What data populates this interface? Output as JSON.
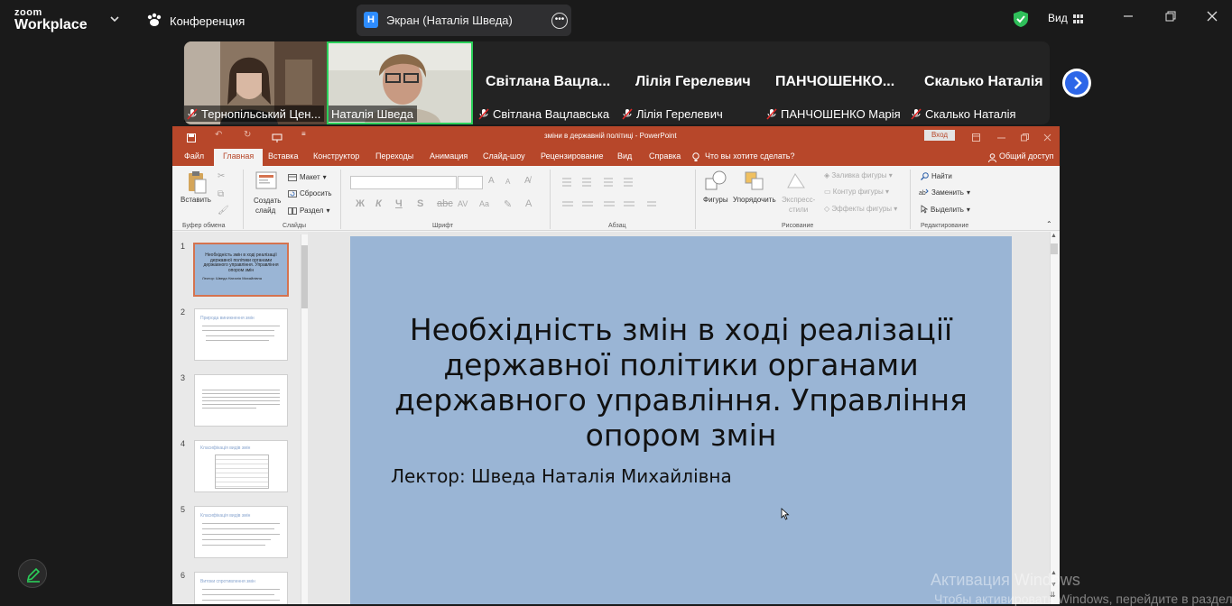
{
  "zoom": {
    "logo_top": "zoom",
    "logo_bottom": "Workplace",
    "meeting_label": "Конференция",
    "share": {
      "badge": "Н",
      "label": "Экран (Наталія Шведа)"
    },
    "view_label": "Вид"
  },
  "participants": {
    "video": [
      {
        "label": "Тернопільський Цен..."
      },
      {
        "label": "Наталія Шведа"
      }
    ],
    "names": [
      {
        "title": "Світлана Вацла...",
        "label": "Світлана Вацлавська"
      },
      {
        "title": "Лілія Герелевич",
        "label": "Лілія Герелевич"
      },
      {
        "title": "ПАНЧОШЕНКО...",
        "label": "ПАНЧОШЕНКО Марія"
      },
      {
        "title": "Скалько Наталія",
        "label": "Скалько Наталія"
      }
    ]
  },
  "powerpoint": {
    "window_title": "зміни в державній політиці  -  PowerPoint",
    "login": "Вход",
    "tabs": [
      "Файл",
      "Главная",
      "Вставка",
      "Конструктор",
      "Переходы",
      "Анимация",
      "Слайд-шоу",
      "Рецензирование",
      "Вид",
      "Справка"
    ],
    "tell_me": "Что вы хотите сделать?",
    "share": "Общий доступ",
    "ribbon": {
      "paste": "Вставить",
      "clipboard": "Буфер обмена",
      "new_slide_1": "Создать",
      "new_slide_2": "слайд",
      "layout": "Макет",
      "reset": "Сбросить",
      "section": "Раздел",
      "slides": "Слайды",
      "font_group": "Шрифт",
      "para_group": "Абзац",
      "shapes": "Фигуры",
      "arrange": "Упорядочить",
      "styles_1": "Экспресс-",
      "styles_2": "стили",
      "fill": "Заливка фигуры",
      "outline": "Контур фигуры",
      "effects": "Эффекты фигуры",
      "drawing": "Рисование",
      "find": "Найти",
      "replace": "Заменить",
      "select": "Выделить",
      "editing": "Редактирование",
      "bold": "Ж",
      "italic": "К",
      "underline": "Ч",
      "strike": "S",
      "spacing": "AV",
      "case": "Aa",
      "grow": "A",
      "shrink": "A"
    },
    "thumbnails": [
      {
        "num": "1",
        "title": "Необхідність змін в ході реалізації державної політики органами державного управління. Управління опором змін",
        "sub": "Лектор: Шведа Наталія Михайлівна"
      },
      {
        "num": "2",
        "title": "Природа виникнення змін"
      },
      {
        "num": "3",
        "title": ""
      },
      {
        "num": "4",
        "title": "Класифікація видів змін"
      },
      {
        "num": "5",
        "title": "Класифікація видів змін"
      },
      {
        "num": "6",
        "title": "Витоки спротивлення змін"
      }
    ],
    "slide": {
      "title": "Необхідність змін в ході реалізації державної політики органами державного управління. Управління опором змін",
      "subtitle": "Лектор: Шведа Наталія Михайлівна"
    }
  },
  "watermark": {
    "line1": "Активация Windows",
    "line2": "Чтобы активировать Windows, перейдите в раздел \"Настройки\", чтоб"
  }
}
